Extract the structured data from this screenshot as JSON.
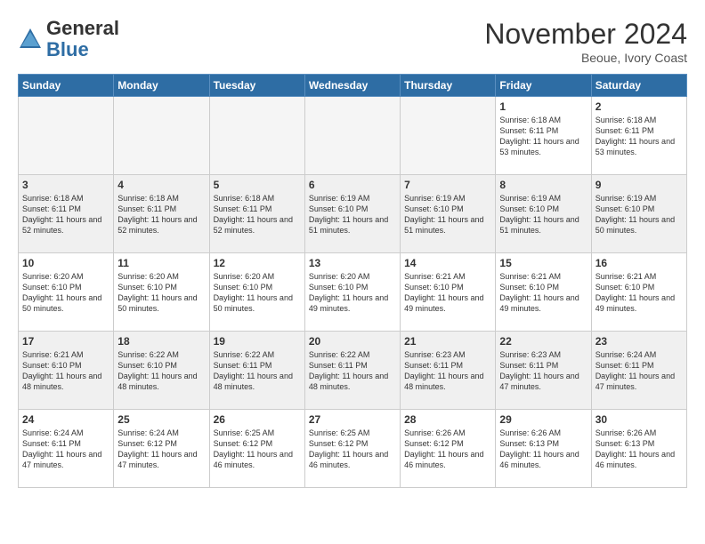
{
  "logo": {
    "general": "General",
    "blue": "Blue"
  },
  "title": "November 2024",
  "location": "Beoue, Ivory Coast",
  "days_header": [
    "Sunday",
    "Monday",
    "Tuesday",
    "Wednesday",
    "Thursday",
    "Friday",
    "Saturday"
  ],
  "weeks": [
    [
      {
        "day": "",
        "text": "",
        "empty": true
      },
      {
        "day": "",
        "text": "",
        "empty": true
      },
      {
        "day": "",
        "text": "",
        "empty": true
      },
      {
        "day": "",
        "text": "",
        "empty": true
      },
      {
        "day": "",
        "text": "",
        "empty": true
      },
      {
        "day": "1",
        "text": "Sunrise: 6:18 AM\nSunset: 6:11 PM\nDaylight: 11 hours\nand 53 minutes.",
        "empty": false
      },
      {
        "day": "2",
        "text": "Sunrise: 6:18 AM\nSunset: 6:11 PM\nDaylight: 11 hours\nand 53 minutes.",
        "empty": false
      }
    ],
    [
      {
        "day": "3",
        "text": "Sunrise: 6:18 AM\nSunset: 6:11 PM\nDaylight: 11 hours\nand 52 minutes.",
        "empty": false
      },
      {
        "day": "4",
        "text": "Sunrise: 6:18 AM\nSunset: 6:11 PM\nDaylight: 11 hours\nand 52 minutes.",
        "empty": false
      },
      {
        "day": "5",
        "text": "Sunrise: 6:18 AM\nSunset: 6:11 PM\nDaylight: 11 hours\nand 52 minutes.",
        "empty": false
      },
      {
        "day": "6",
        "text": "Sunrise: 6:19 AM\nSunset: 6:10 PM\nDaylight: 11 hours\nand 51 minutes.",
        "empty": false
      },
      {
        "day": "7",
        "text": "Sunrise: 6:19 AM\nSunset: 6:10 PM\nDaylight: 11 hours\nand 51 minutes.",
        "empty": false
      },
      {
        "day": "8",
        "text": "Sunrise: 6:19 AM\nSunset: 6:10 PM\nDaylight: 11 hours\nand 51 minutes.",
        "empty": false
      },
      {
        "day": "9",
        "text": "Sunrise: 6:19 AM\nSunset: 6:10 PM\nDaylight: 11 hours\nand 50 minutes.",
        "empty": false
      }
    ],
    [
      {
        "day": "10",
        "text": "Sunrise: 6:20 AM\nSunset: 6:10 PM\nDaylight: 11 hours\nand 50 minutes.",
        "empty": false
      },
      {
        "day": "11",
        "text": "Sunrise: 6:20 AM\nSunset: 6:10 PM\nDaylight: 11 hours\nand 50 minutes.",
        "empty": false
      },
      {
        "day": "12",
        "text": "Sunrise: 6:20 AM\nSunset: 6:10 PM\nDaylight: 11 hours\nand 50 minutes.",
        "empty": false
      },
      {
        "day": "13",
        "text": "Sunrise: 6:20 AM\nSunset: 6:10 PM\nDaylight: 11 hours\nand 49 minutes.",
        "empty": false
      },
      {
        "day": "14",
        "text": "Sunrise: 6:21 AM\nSunset: 6:10 PM\nDaylight: 11 hours\nand 49 minutes.",
        "empty": false
      },
      {
        "day": "15",
        "text": "Sunrise: 6:21 AM\nSunset: 6:10 PM\nDaylight: 11 hours\nand 49 minutes.",
        "empty": false
      },
      {
        "day": "16",
        "text": "Sunrise: 6:21 AM\nSunset: 6:10 PM\nDaylight: 11 hours\nand 49 minutes.",
        "empty": false
      }
    ],
    [
      {
        "day": "17",
        "text": "Sunrise: 6:21 AM\nSunset: 6:10 PM\nDaylight: 11 hours\nand 48 minutes.",
        "empty": false
      },
      {
        "day": "18",
        "text": "Sunrise: 6:22 AM\nSunset: 6:10 PM\nDaylight: 11 hours\nand 48 minutes.",
        "empty": false
      },
      {
        "day": "19",
        "text": "Sunrise: 6:22 AM\nSunset: 6:11 PM\nDaylight: 11 hours\nand 48 minutes.",
        "empty": false
      },
      {
        "day": "20",
        "text": "Sunrise: 6:22 AM\nSunset: 6:11 PM\nDaylight: 11 hours\nand 48 minutes.",
        "empty": false
      },
      {
        "day": "21",
        "text": "Sunrise: 6:23 AM\nSunset: 6:11 PM\nDaylight: 11 hours\nand 48 minutes.",
        "empty": false
      },
      {
        "day": "22",
        "text": "Sunrise: 6:23 AM\nSunset: 6:11 PM\nDaylight: 11 hours\nand 47 minutes.",
        "empty": false
      },
      {
        "day": "23",
        "text": "Sunrise: 6:24 AM\nSunset: 6:11 PM\nDaylight: 11 hours\nand 47 minutes.",
        "empty": false
      }
    ],
    [
      {
        "day": "24",
        "text": "Sunrise: 6:24 AM\nSunset: 6:11 PM\nDaylight: 11 hours\nand 47 minutes.",
        "empty": false
      },
      {
        "day": "25",
        "text": "Sunrise: 6:24 AM\nSunset: 6:12 PM\nDaylight: 11 hours\nand 47 minutes.",
        "empty": false
      },
      {
        "day": "26",
        "text": "Sunrise: 6:25 AM\nSunset: 6:12 PM\nDaylight: 11 hours\nand 46 minutes.",
        "empty": false
      },
      {
        "day": "27",
        "text": "Sunrise: 6:25 AM\nSunset: 6:12 PM\nDaylight: 11 hours\nand 46 minutes.",
        "empty": false
      },
      {
        "day": "28",
        "text": "Sunrise: 6:26 AM\nSunset: 6:12 PM\nDaylight: 11 hours\nand 46 minutes.",
        "empty": false
      },
      {
        "day": "29",
        "text": "Sunrise: 6:26 AM\nSunset: 6:13 PM\nDaylight: 11 hours\nand 46 minutes.",
        "empty": false
      },
      {
        "day": "30",
        "text": "Sunrise: 6:26 AM\nSunset: 6:13 PM\nDaylight: 11 hours\nand 46 minutes.",
        "empty": false
      }
    ]
  ]
}
